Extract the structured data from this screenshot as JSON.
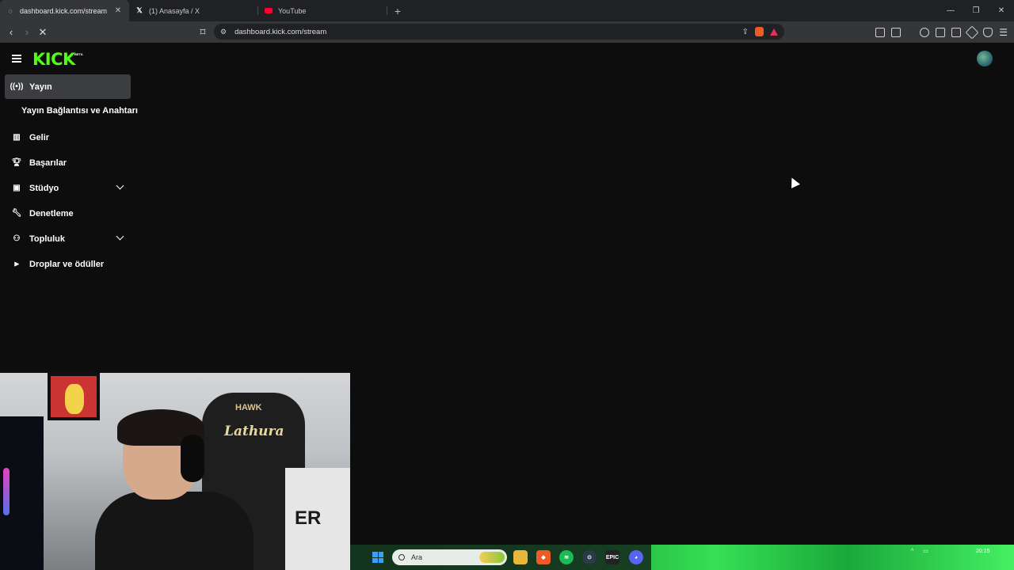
{
  "browser": {
    "tabs": [
      {
        "title": "dashboard.kick.com/stream",
        "active": true
      },
      {
        "title": "(1) Anasayfa / X",
        "active": false
      },
      {
        "title": "YouTube",
        "active": false
      }
    ],
    "url": "dashboard.kick.com/stream"
  },
  "app": {
    "logo": "KICK",
    "logo_badge": "BETA",
    "brand_color": "#53fc18"
  },
  "sidebar": {
    "items": [
      {
        "label": "Yayın",
        "icon": "broadcast-icon",
        "active": true
      },
      {
        "label": "Yayın Bağlantısı ve Anahtarı",
        "sub": true
      },
      {
        "label": "Gelir",
        "icon": "revenue-chart-icon"
      },
      {
        "label": "Başarılar",
        "icon": "trophy-icon"
      },
      {
        "label": "Stüdyo",
        "icon": "studio-icon",
        "expandable": true
      },
      {
        "label": "Denetleme",
        "icon": "wrench-icon"
      },
      {
        "label": "Topluluk",
        "icon": "community-icon",
        "expandable": true
      },
      {
        "label": "Droplar ve ödüller",
        "icon": "drops-icon"
      }
    ]
  },
  "webcam": {
    "chair_brand": "HAWK",
    "chair_text": "Lathura",
    "shirt_text": "ER"
  },
  "taskbar": {
    "search_placeholder": "Ara",
    "apps": [
      "file-explorer",
      "brave",
      "spotify",
      "steam",
      "epic-games",
      "discord"
    ],
    "epic_label": "EPIC",
    "clock_time": "20:15"
  }
}
